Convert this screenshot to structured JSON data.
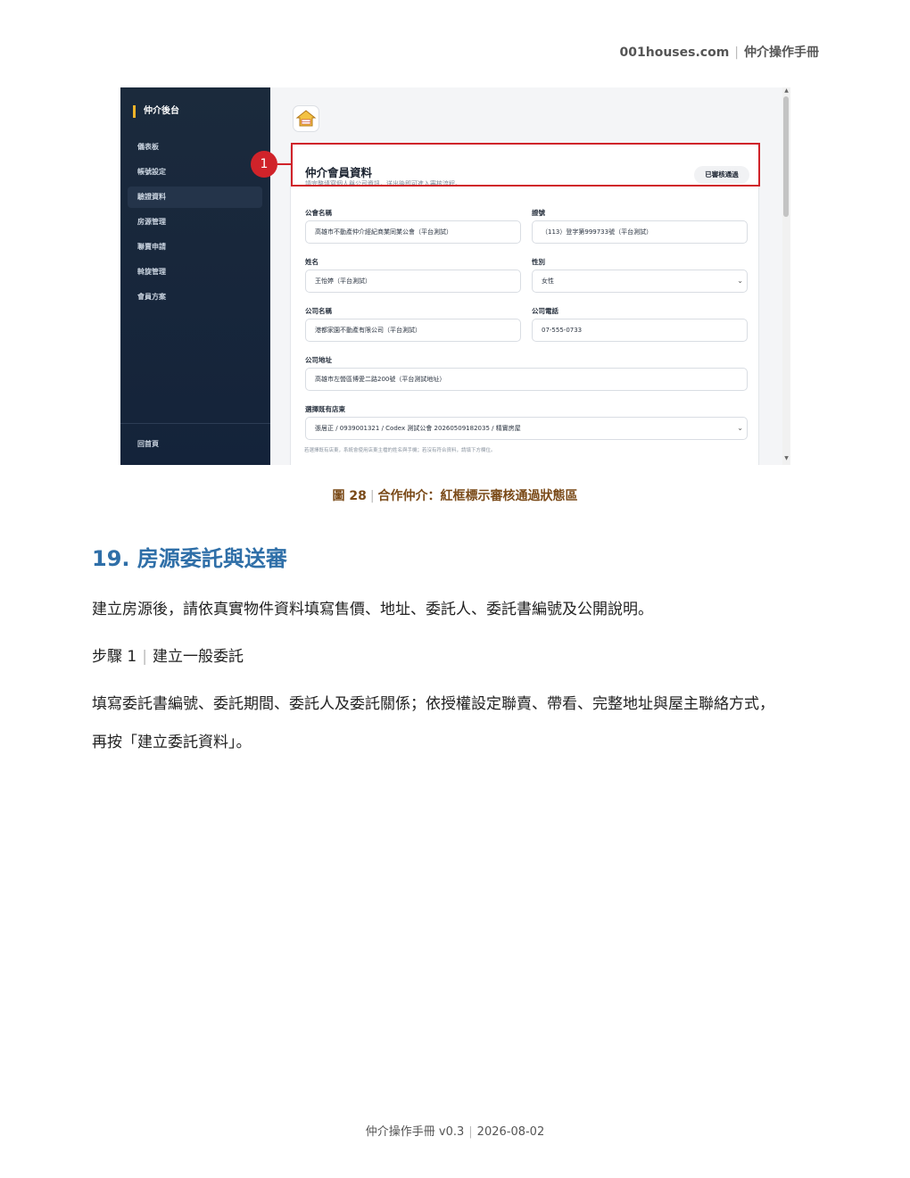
{
  "header": {
    "site": "001houses.com",
    "manual": "仲介操作手冊"
  },
  "screenshot": {
    "sidebar": {
      "title": "仲介後台",
      "items": [
        {
          "label": "儀表板"
        },
        {
          "label": "帳號設定"
        },
        {
          "label": "驗證資料",
          "active": true
        },
        {
          "label": "房源管理"
        },
        {
          "label": "聯賣申請"
        },
        {
          "label": "斡旋管理"
        },
        {
          "label": "會員方案"
        }
      ],
      "home": "回首頁"
    },
    "marker_number": "1",
    "card": {
      "title": "仲介會員資料",
      "subtitle": "請完整填寫個人與公司資訊，送出後即可進入審核流程。",
      "status_badge": "已審核通過",
      "fields": {
        "association_label": "公會名稱",
        "association_value": "高雄市不動產仲介經紀商業同業公會（平台測試）",
        "license_label": "證號",
        "license_value": "（113）登字第999733號（平台測試）",
        "name_label": "姓名",
        "name_value": "王怡婷（平台測試）",
        "gender_label": "性別",
        "gender_value": "女性",
        "company_label": "公司名稱",
        "company_value": "港都家園不動產有限公司（平台測試）",
        "phone_label": "公司電話",
        "phone_value": "07-555-0733",
        "address_label": "公司地址",
        "address_value": "高雄市左營區博愛二路200號（平台測試地址）",
        "store_label": "選擇既有店東",
        "store_value": "張居正 / 0939001321 / Codex 測試公會 20260509182035 / 精實房屋",
        "store_hint": "若選擇既有店東，系統會使用店東主檔的姓名與手機；若沒有符合資料，請填下方欄位。"
      }
    }
  },
  "caption": {
    "figure": "圖 28",
    "text": "合作仲介：紅框標示審核通過狀態區"
  },
  "section": {
    "title": "19. 房源委託與送審",
    "para1": "建立房源後，請依真實物件資料填寫售價、地址、委託人、委託書編號及公開說明。",
    "step_label": "步驟 1",
    "step_text": "建立一般委託",
    "para2_line1": "填寫委託書編號、委託期間、委託人及委託關係；依授權設定聯賣、帶看、完整地址與屋主聯絡方式，",
    "para2_line2": "再按「建立委託資料」。"
  },
  "footer": {
    "version": "仲介操作手冊 v0.3",
    "date": "2026-08-02"
  }
}
